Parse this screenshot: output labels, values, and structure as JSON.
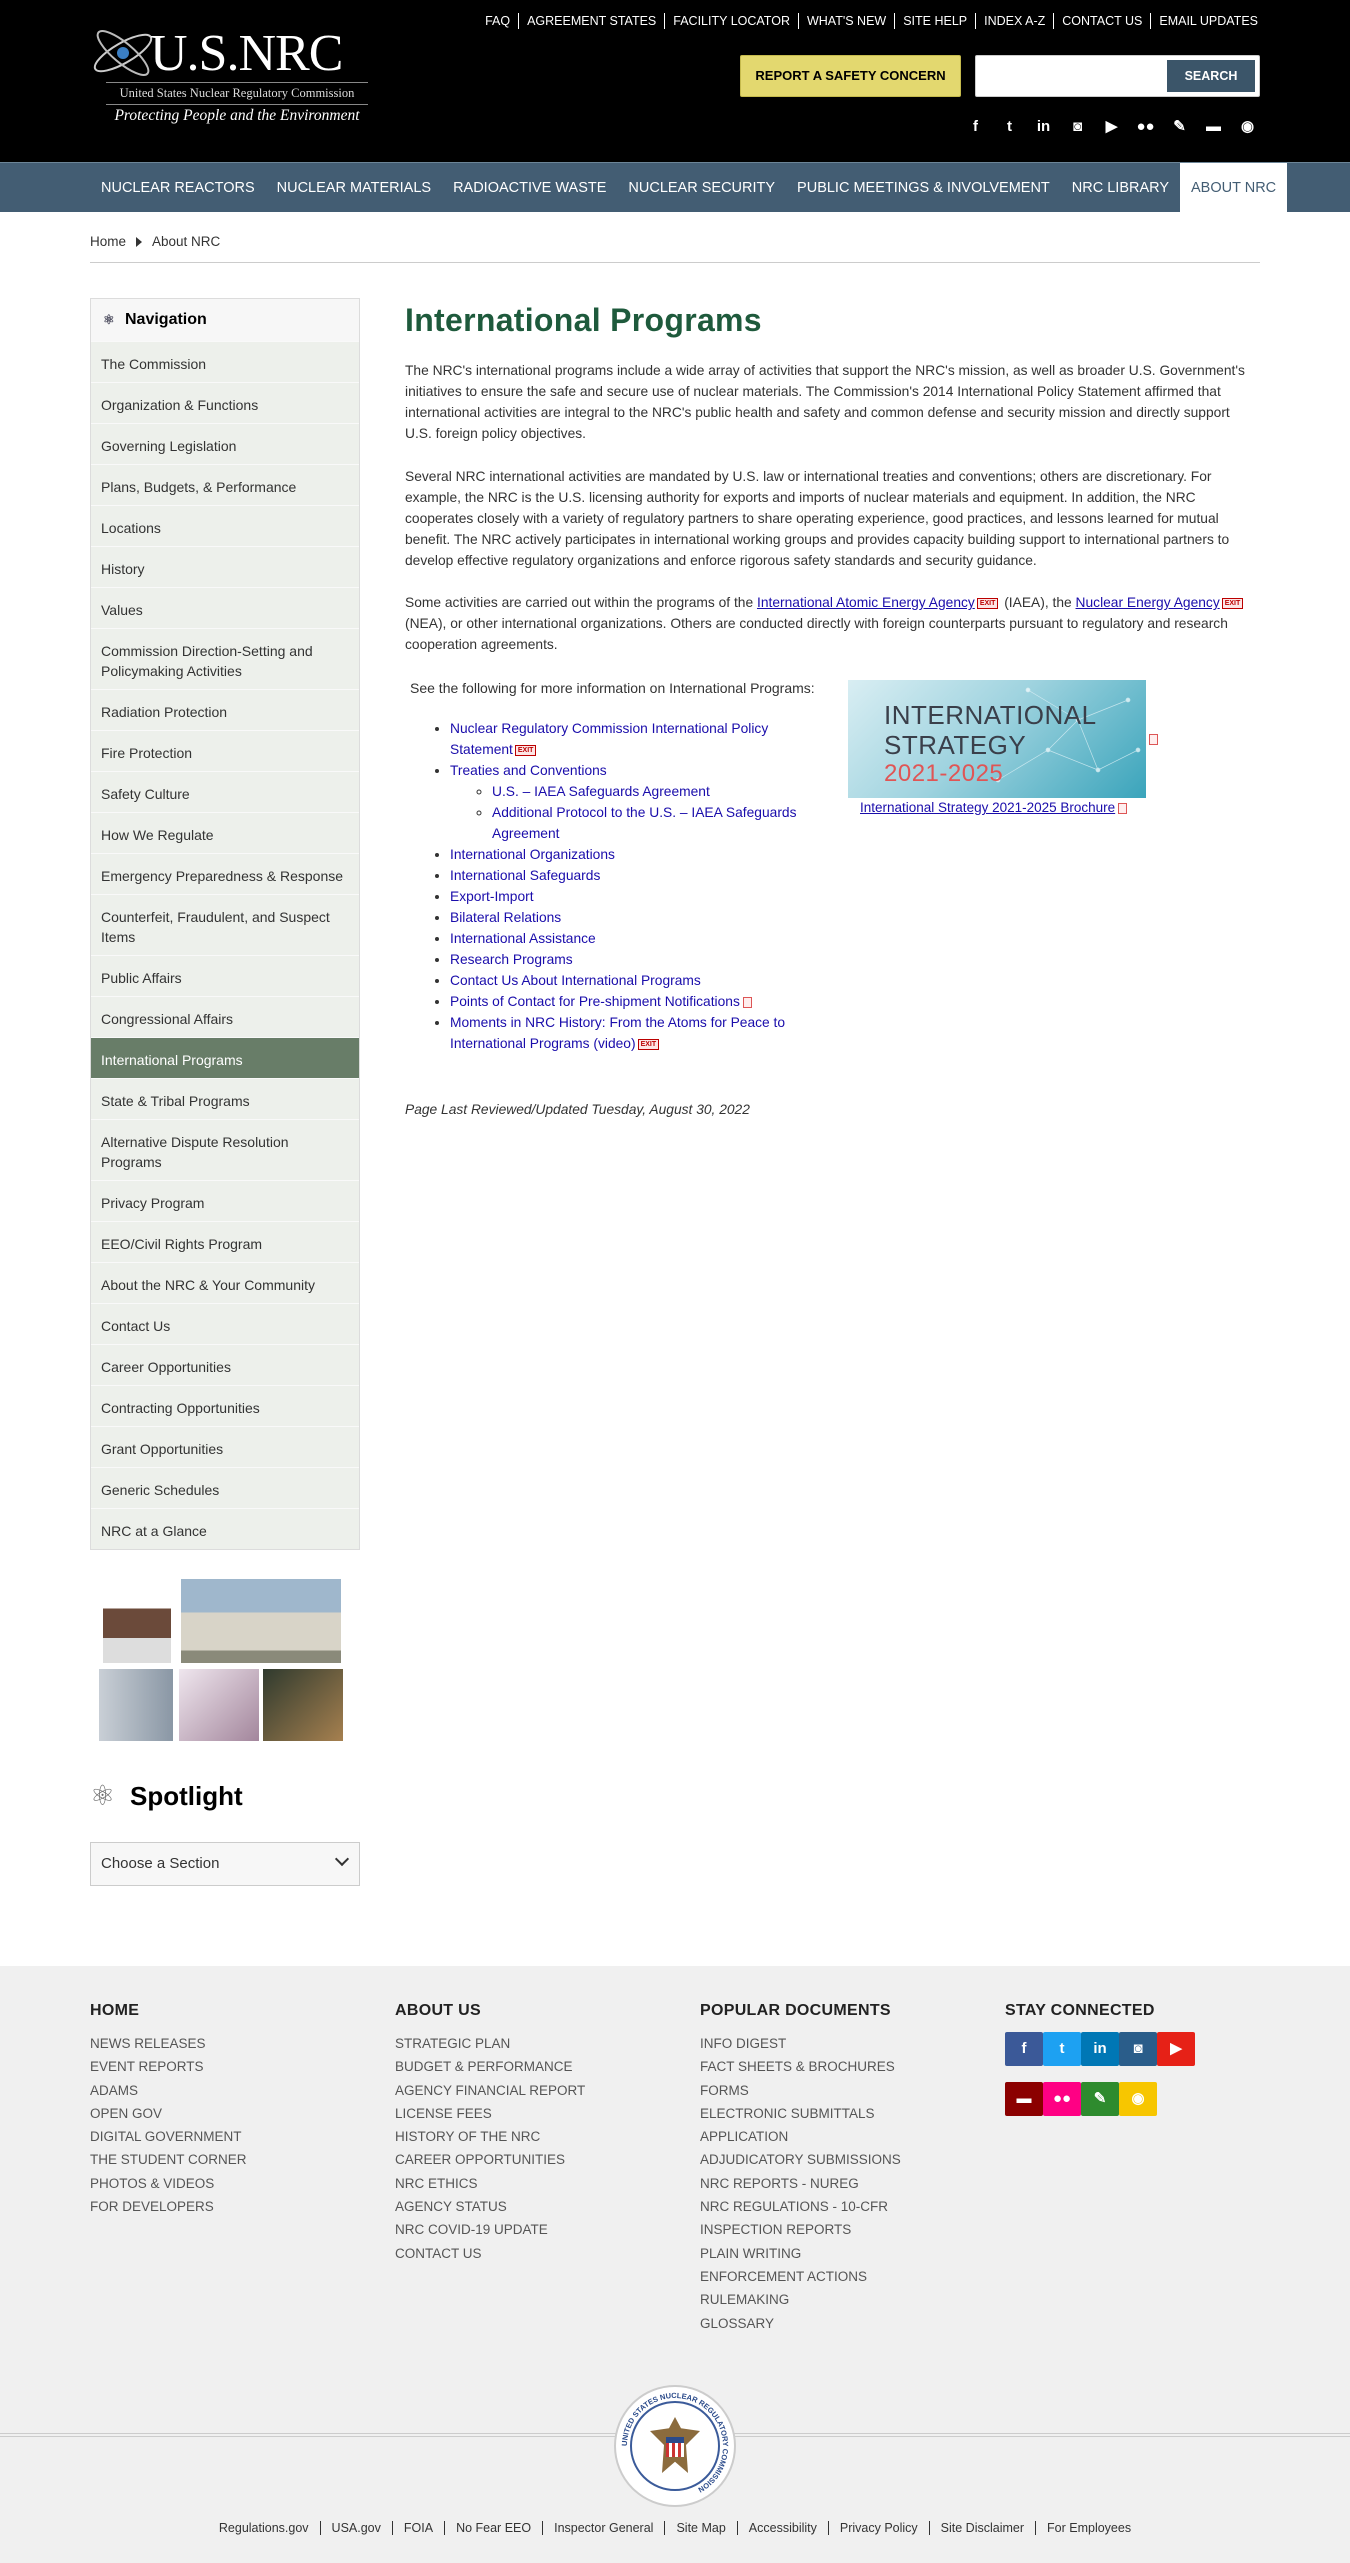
{
  "header": {
    "logo_text": "U.S.NRC",
    "logo_subtitle": "United States Nuclear Regulatory Commission",
    "logo_tagline": "Protecting People and the Environment",
    "utility_links": [
      "FAQ",
      "AGREEMENT STATES",
      "FACILITY LOCATOR",
      "WHAT'S NEW",
      "SITE HELP",
      "INDEX A-Z",
      "CONTACT US",
      "EMAIL UPDATES"
    ],
    "report_button": "REPORT A SAFETY CONCERN",
    "search_placeholder": "",
    "search_button": "SEARCH",
    "social_icons": [
      "facebook-icon",
      "twitter-icon",
      "linkedin-icon",
      "instagram-icon",
      "youtube-icon",
      "flickr-icon",
      "blog-icon",
      "comment-icon",
      "rss-icon"
    ]
  },
  "mainnav": {
    "items": [
      "NUCLEAR REACTORS",
      "NUCLEAR MATERIALS",
      "RADIOACTIVE WASTE",
      "NUCLEAR SECURITY",
      "PUBLIC MEETINGS & INVOLVEMENT",
      "NRC LIBRARY",
      "ABOUT NRC"
    ],
    "active": "ABOUT NRC"
  },
  "breadcrumb": [
    "Home",
    "About NRC"
  ],
  "sidenav": {
    "heading": "Navigation",
    "items": [
      "The Commission",
      "Organization & Functions",
      "Governing Legislation",
      "Plans, Budgets, & Performance",
      "Locations",
      "History",
      "Values",
      "Commission Direction-Setting and Policymaking Activities",
      "Radiation Protection",
      "Fire Protection",
      "Safety Culture",
      "How We Regulate",
      "Emergency Preparedness & Response",
      "Counterfeit, Fraudulent, and Suspect Items",
      "Public Affairs",
      "Congressional Affairs",
      "International Programs",
      "State & Tribal Programs",
      "Alternative Dispute Resolution Programs",
      "Privacy Program",
      "EEO/Civil Rights Program",
      "About the NRC & Your Community",
      "Contact Us",
      "Career Opportunities",
      "Contracting Opportunities",
      "Grant Opportunities",
      "Generic Schedules",
      "NRC at a Glance"
    ],
    "active": "International Programs"
  },
  "spotlight": {
    "title": "Spotlight",
    "select_value": "Choose a Section"
  },
  "content": {
    "title": "International Programs",
    "p1": "The NRC's international programs include a wide array of activities that support the NRC's mission, as well as broader U.S. Government's initiatives to ensure the safe and secure use of nuclear materials. The Commission's 2014 International Policy Statement affirmed that international activities are integral to the NRC's public health and safety and common defense and security mission and directly support U.S. foreign policy objectives.",
    "p2": "Several NRC international activities are mandated by U.S. law or international treaties and conventions; others are discretionary. For example, the NRC is the U.S. licensing authority for exports and imports of nuclear materials and equipment. In addition, the NRC cooperates closely with a variety of regulatory partners to share operating experience, good practices, and lessons learned for mutual benefit. The NRC actively participates in international working groups and provides capacity building support to international partners to develop effective regulatory organizations and enforce rigorous safety standards and security guidance.",
    "p3": {
      "pre": "Some activities are carried out within the programs of the ",
      "link1": "International Atomic Energy Agency",
      "mid1": " (IAEA), the ",
      "link2": "Nuclear Energy Agency",
      "post": " (NEA), or other international organizations. Others are conducted directly with foreign counterparts pursuant to regulatory and research cooperation agreements."
    },
    "exit_label": "EXIT",
    "see_following": "See the following for more information on International Programs:",
    "links": {
      "policy_statement": "Nuclear Regulatory Commission International Policy Statement",
      "treaties": "Treaties and Conventions",
      "treaties_sub1": "U.S. – IAEA Safeguards Agreement",
      "treaties_sub2": "Additional Protocol to the U.S. – IAEA Safeguards Agreement",
      "organizations": "International Organizations",
      "safeguards": "International Safeguards",
      "export_import": "Export-Import",
      "bilateral": "Bilateral Relations",
      "assistance": "International Assistance",
      "research": "Research Programs",
      "contact": "Contact Us About International Programs",
      "points_of_contact": "Points of Contact for Pre-shipment Notifications",
      "moments": "Moments in NRC History: From the Atoms for Peace to International Programs (video)"
    },
    "brochure_image_text": [
      "INTERNATIONAL",
      "STRATEGY",
      "2021-2025"
    ],
    "brochure_caption": "International Strategy 2021-2025 Brochure",
    "last_reviewed": "Page Last Reviewed/Updated Tuesday, August 30, 2022"
  },
  "footer": {
    "col1": {
      "heading": "HOME",
      "links": [
        "NEWS RELEASES",
        "EVENT REPORTS",
        "ADAMS",
        "OPEN GOV",
        "DIGITAL GOVERNMENT",
        "THE STUDENT CORNER",
        "PHOTOS & VIDEOS",
        "FOR DEVELOPERS"
      ]
    },
    "col2": {
      "heading": "ABOUT US",
      "links": [
        "STRATEGIC PLAN",
        "BUDGET & PERFORMANCE",
        "AGENCY FINANCIAL REPORT",
        "LICENSE FEES",
        "HISTORY OF THE NRC",
        "CAREER OPPORTUNITIES",
        "NRC ETHICS",
        "AGENCY STATUS",
        "NRC COVID-19 UPDATE",
        "CONTACT US"
      ]
    },
    "col3": {
      "heading": "POPULAR DOCUMENTS",
      "links": [
        "INFO DIGEST",
        "FACT SHEETS & BROCHURES",
        "FORMS",
        "ELECTRONIC SUBMITTALS",
        "APPLICATION",
        "ADJUDICATORY SUBMISSIONS",
        "NRC REPORTS - NUREG",
        "NRC REGULATIONS - 10-CFR",
        "INSPECTION REPORTS",
        "PLAIN WRITING",
        "ENFORCEMENT ACTIONS",
        "RULEMAKING",
        "GLOSSARY"
      ]
    },
    "col4": {
      "heading": "STAY CONNECTED"
    },
    "social": [
      {
        "name": "facebook-icon",
        "glyph": "f",
        "color": "#3b5998"
      },
      {
        "name": "twitter-icon",
        "glyph": "t",
        "color": "#1da1f2"
      },
      {
        "name": "linkedin-icon",
        "glyph": "in",
        "color": "#0077b5"
      },
      {
        "name": "instagram-icon",
        "glyph": "◙",
        "color": "#2a5d8a"
      },
      {
        "name": "youtube-icon",
        "glyph": "▶",
        "color": "#e62117"
      },
      {
        "name": "comment-icon",
        "glyph": "▬",
        "color": "#8b0000"
      },
      {
        "name": "flickr-icon",
        "glyph": "●●",
        "color": "#ff0084"
      },
      {
        "name": "blog-icon",
        "glyph": "✎",
        "color": "#2e8b2e"
      },
      {
        "name": "rss-icon",
        "glyph": "◉",
        "color": "#f7c600"
      }
    ],
    "seal_text": "UNITED STATES NUCLEAR REGULATORY COMMISSION",
    "bottom_links": [
      "Regulations.gov",
      "USA.gov",
      "FOIA",
      "No Fear EEO",
      "Inspector General",
      "Site Map",
      "Accessibility",
      "Privacy Policy",
      "Site Disclaimer",
      "For Employees"
    ]
  },
  "colors": {
    "header_bg": "#000000",
    "nav_bg": "#435d73",
    "report_button": "#e3d86f",
    "title_green": "#1e5a3c",
    "sidenav_active": "#687d68"
  }
}
